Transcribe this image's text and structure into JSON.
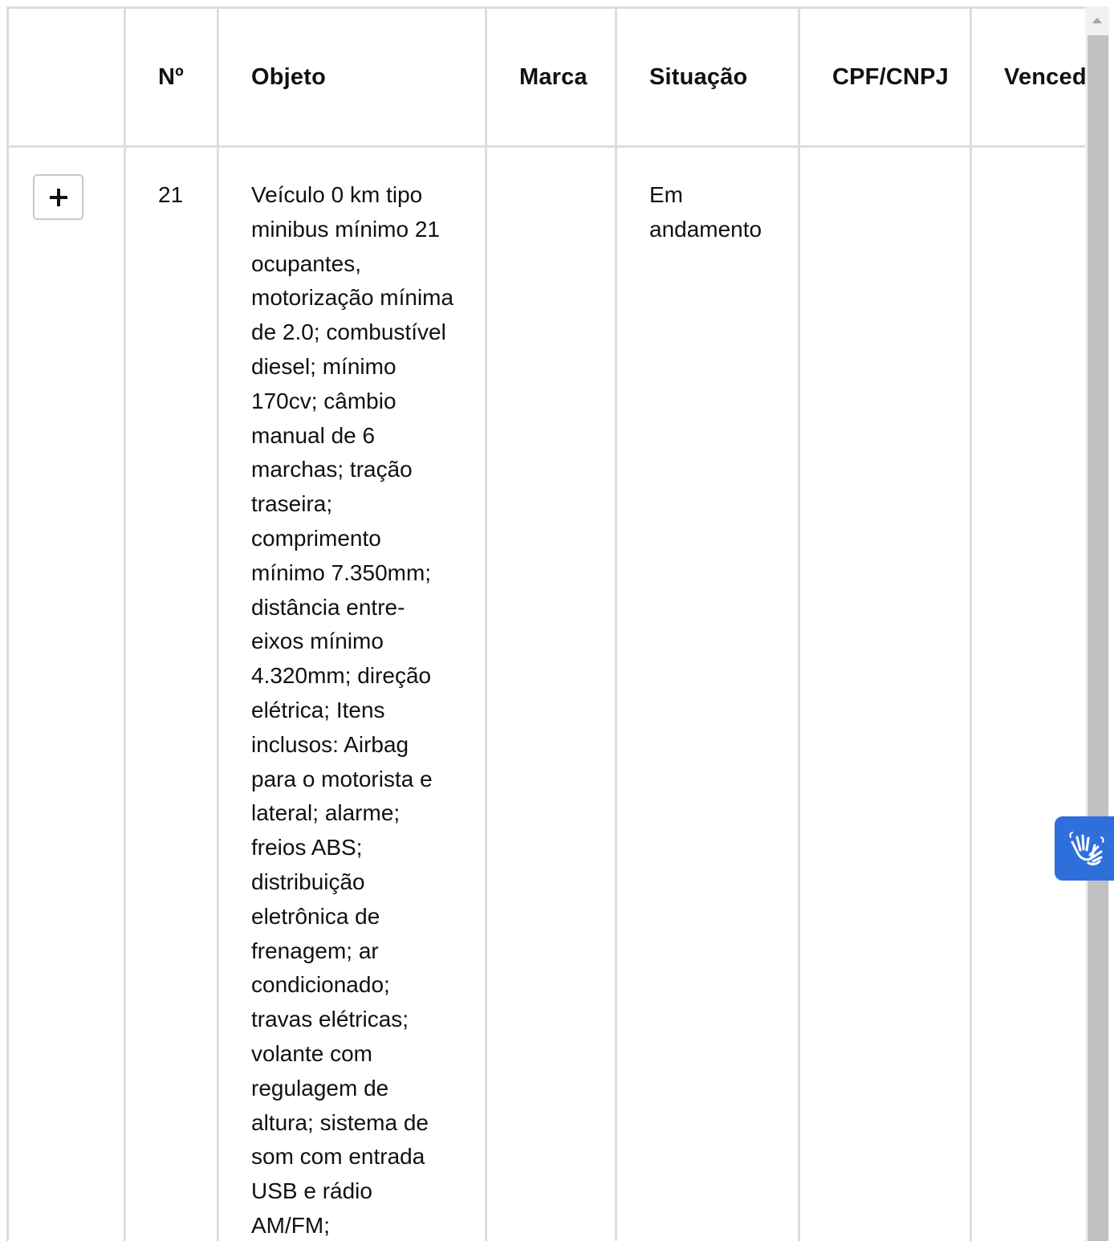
{
  "table": {
    "headers": {
      "expand": "",
      "number": "Nº",
      "object": "Objeto",
      "brand": "Marca",
      "status": "Situação",
      "tax_id": "CPF/CNPJ",
      "winner": "Vencedor"
    },
    "rows": [
      {
        "expand_label": "+",
        "number": "21",
        "object": "Veículo 0 km tipo minibus mínimo 21 ocupantes, motorização mínima de 2.0; combustível diesel; mínimo 170cv; câmbio manual de 6 marchas; tração traseira; comprimento mínimo 7.350mm; distância entre-eixos mínimo 4.320mm; direção elétrica; Itens inclusos: Airbag para o motorista e lateral; alarme; freios ABS; distribuição eletrônica de frenagem; ar condicionado; travas elétricas; volante com regulagem de altura; sistema de som com entrada USB e rádio AM/FM;",
        "brand": "",
        "status": "Em andamento",
        "tax_id": "",
        "winner": ""
      }
    ]
  },
  "accessibility_widget": {
    "icon": "sign-language-hands-icon",
    "color": "#2f6fdc"
  }
}
